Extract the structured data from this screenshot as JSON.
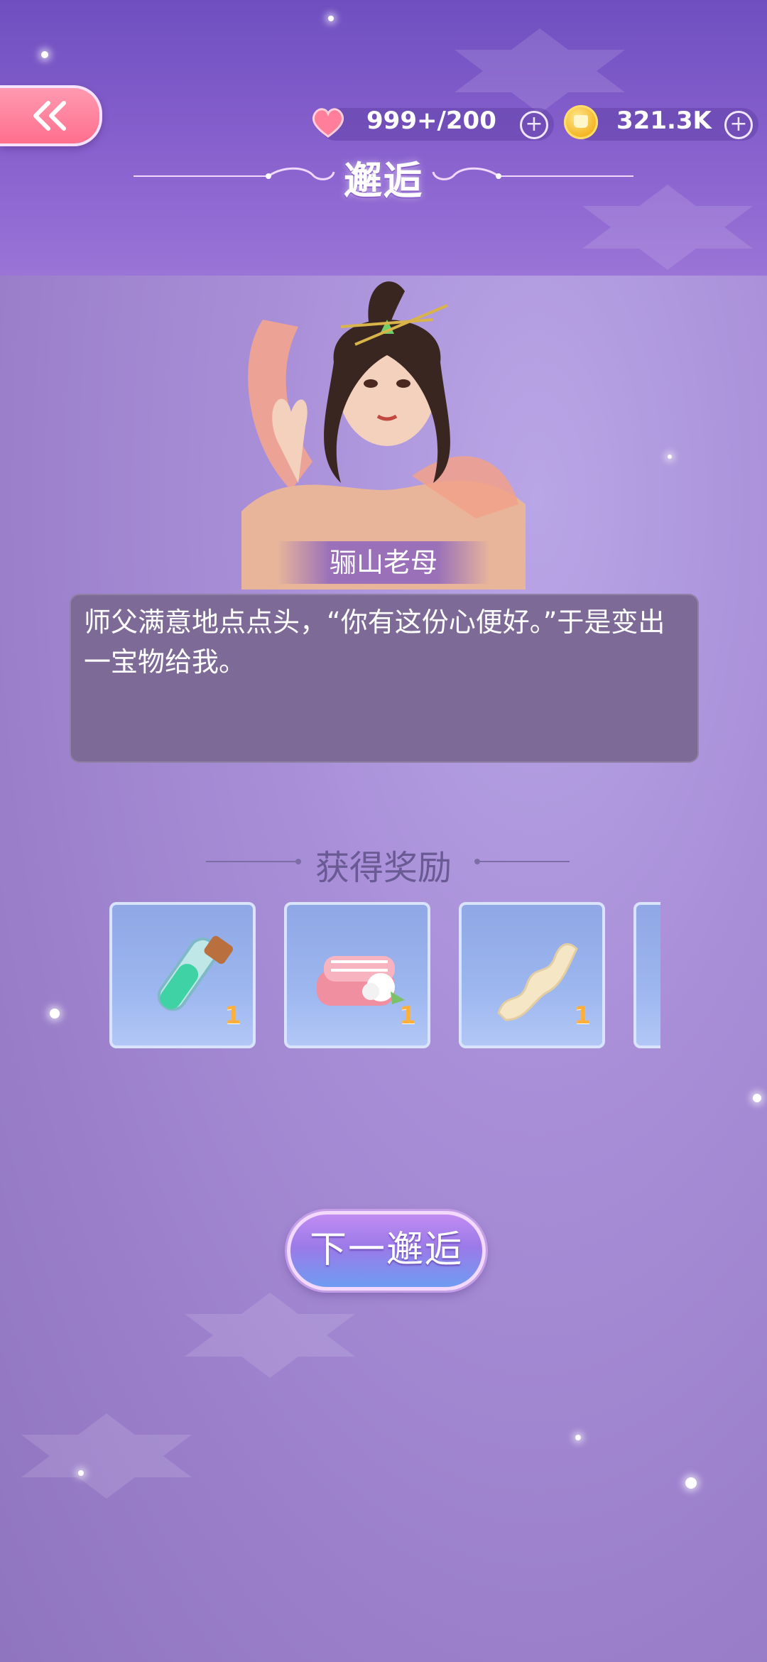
{
  "header": {
    "title": "邂逅",
    "hearts": "999+/200",
    "coins": "321.3K"
  },
  "character": {
    "name": "骊山老母"
  },
  "dialog": {
    "text": "师父满意地点点头，“你有这份心便好。”于是变出一宝物给我。"
  },
  "rewards": {
    "title": "获得奖励",
    "items": [
      {
        "icon": "potion-vial-icon",
        "count": "1"
      },
      {
        "icon": "pink-towel-icon",
        "count": "1"
      },
      {
        "icon": "silk-ribbon-icon",
        "count": "1"
      },
      {
        "icon": "partial-item",
        "count": ""
      }
    ]
  },
  "next_button": {
    "label": "下一邂逅"
  },
  "colors": {
    "background": "#a98fd8",
    "dialog": "#7e6a96",
    "back_button": "#ff7f9a",
    "reward_count": "#ffb03b"
  }
}
